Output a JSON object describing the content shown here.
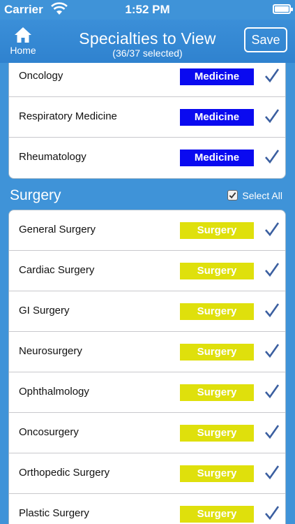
{
  "status_bar": {
    "carrier": "Carrier",
    "time": "1:52 PM",
    "battery_level": 0.92
  },
  "nav": {
    "home_label": "Home",
    "title": "Specialties to View",
    "subtitle": "(36/37 selected)",
    "save_label": "Save"
  },
  "colors": {
    "background": "#3f93d8",
    "medicine_tag": "#0a0af0",
    "surgery_tag": "#dfe00c",
    "checkmark": "#3b5fa0"
  },
  "medicine_rows": [
    {
      "name": "Oncology",
      "tag": "Medicine",
      "checked": true
    },
    {
      "name": "Respiratory Medicine",
      "tag": "Medicine",
      "checked": true
    },
    {
      "name": "Rheumatology",
      "tag": "Medicine",
      "checked": true
    }
  ],
  "surgery_section": {
    "title": "Surgery",
    "select_all_label": "Select All",
    "select_all_checked": true
  },
  "surgery_rows": [
    {
      "name": "General Surgery",
      "tag": "Surgery",
      "checked": true
    },
    {
      "name": "Cardiac Surgery",
      "tag": "Surgery",
      "checked": true
    },
    {
      "name": "GI Surgery",
      "tag": "Surgery",
      "checked": true
    },
    {
      "name": "Neurosurgery",
      "tag": "Surgery",
      "checked": true
    },
    {
      "name": "Ophthalmology",
      "tag": "Surgery",
      "checked": true
    },
    {
      "name": "Oncosurgery",
      "tag": "Surgery",
      "checked": true
    },
    {
      "name": "Orthopedic Surgery",
      "tag": "Surgery",
      "checked": true
    },
    {
      "name": "Plastic Surgery",
      "tag": "Surgery",
      "checked": true
    }
  ]
}
